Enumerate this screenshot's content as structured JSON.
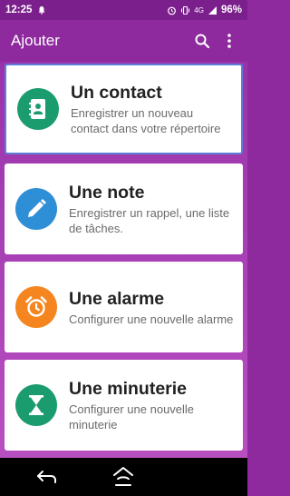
{
  "status": {
    "time": "12:25",
    "network": "4G",
    "battery": "96%"
  },
  "appbar": {
    "title": "Ajouter"
  },
  "cards": [
    {
      "title": "Un contact",
      "desc": "Enregistrer un nouveau contact dans votre répertoire",
      "color": "#1b9c6f",
      "icon": "contact-icon"
    },
    {
      "title": "Une note",
      "desc": "Enregistrer un rappel, une liste de tâches.",
      "color": "#2e8fd6",
      "icon": "pencil-icon"
    },
    {
      "title": "Une alarme",
      "desc": "Configurer une nouvelle alarme",
      "color": "#f5851f",
      "icon": "alarm-clock-icon"
    },
    {
      "title": "Une minuterie",
      "desc": "Configurer une nouvelle minuterie",
      "color": "#1b9c6f",
      "icon": "hourglass-icon"
    }
  ]
}
